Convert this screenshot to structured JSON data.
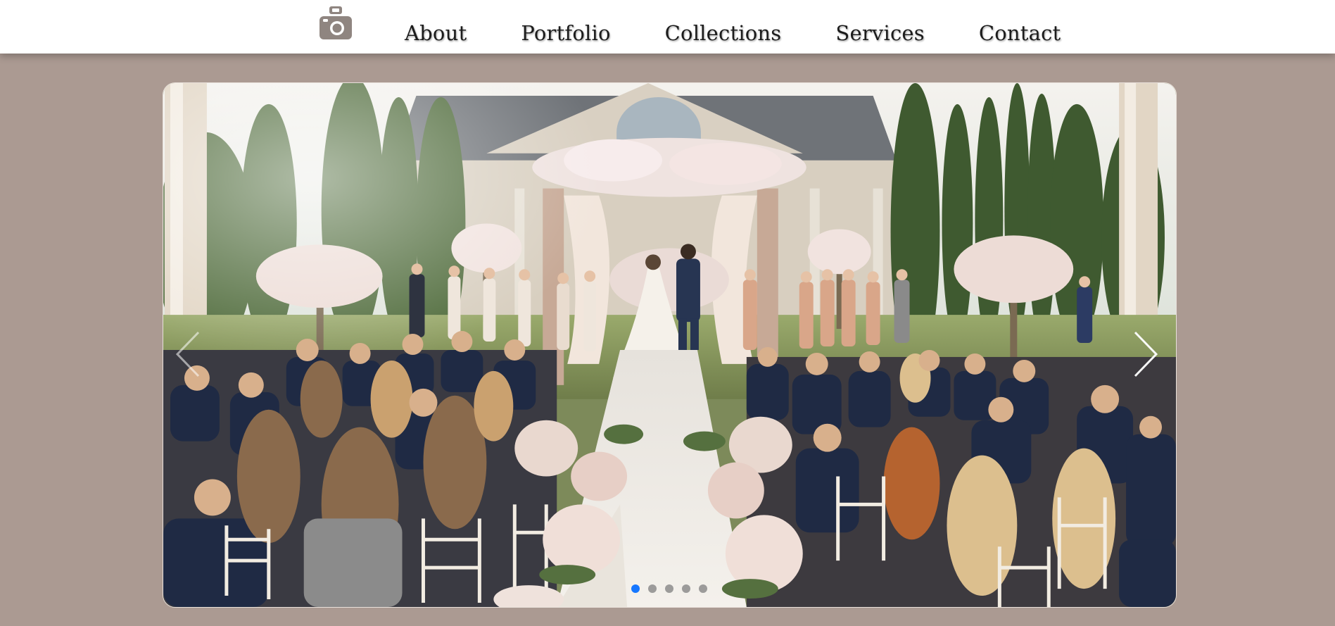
{
  "nav": {
    "logo_icon": "camera-icon",
    "links": [
      {
        "label": "About"
      },
      {
        "label": "Portfolio"
      },
      {
        "label": "Collections"
      },
      {
        "label": "Services"
      },
      {
        "label": "Contact"
      }
    ]
  },
  "slider": {
    "image_subject": "outdoor-wedding-ceremony-photo",
    "prev_icon": "chevron-left-icon",
    "next_icon": "chevron-right-icon",
    "slide_count": 5,
    "active_slide": 1
  },
  "colors": {
    "page_background": "#ab9a92",
    "navbar_background": "#ffffff",
    "active_dot": "#1677ff",
    "inactive_dot": "#8c8c8c"
  }
}
